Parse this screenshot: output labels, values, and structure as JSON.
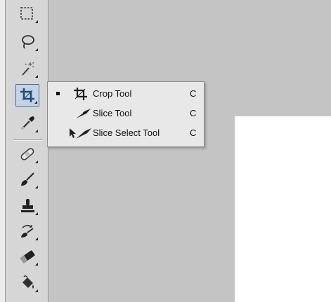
{
  "tools": [
    {
      "name": "rectangular-marquee",
      "icon": "marquee-icon"
    },
    {
      "name": "lasso",
      "icon": "lasso-icon"
    },
    {
      "name": "quick-selection",
      "icon": "magic-wand-icon"
    },
    {
      "name": "crop",
      "icon": "crop-icon",
      "selected": true
    },
    {
      "name": "eyedropper",
      "icon": "eyedropper-icon"
    },
    {
      "name": "spot-healing",
      "icon": "bandage-icon"
    },
    {
      "name": "brush",
      "icon": "brush-icon"
    },
    {
      "name": "clone-stamp",
      "icon": "stamp-icon"
    },
    {
      "name": "history-brush",
      "icon": "history-brush-icon"
    },
    {
      "name": "eraser",
      "icon": "eraser-icon"
    },
    {
      "name": "paint-bucket",
      "icon": "bucket-icon"
    }
  ],
  "flyout": {
    "items": [
      {
        "label": "Crop Tool",
        "shortcut": "C",
        "icon": "crop-icon",
        "active": true
      },
      {
        "label": "Slice Tool",
        "shortcut": "C",
        "icon": "slice-icon",
        "active": false
      },
      {
        "label": "Slice Select Tool",
        "shortcut": "C",
        "icon": "slice-select-icon",
        "active": false
      }
    ]
  },
  "colors": {
    "workspace": "#c4c4c4",
    "toolbar": "#d6d6d6",
    "selection_accent": "#4e6f98",
    "canvas": "#ffffff"
  }
}
